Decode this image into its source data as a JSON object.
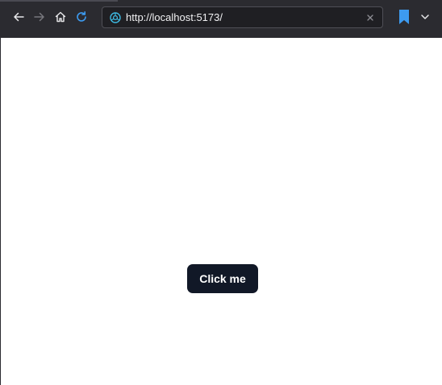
{
  "browser": {
    "url": "http://localhost:5173/",
    "icons": {
      "back": "arrow-left-icon",
      "forward": "arrow-right-icon",
      "home": "home-icon",
      "reload": "reload-icon",
      "site": "site-identity-icon",
      "clear": "close-icon",
      "bookmark": "bookmark-icon",
      "menu": "chevron-down-icon"
    },
    "colors": {
      "toolbar_bg": "#2b2b30",
      "accent": "#3d9bf0"
    }
  },
  "page": {
    "button_label": "Click me",
    "button_bg": "#111827"
  }
}
